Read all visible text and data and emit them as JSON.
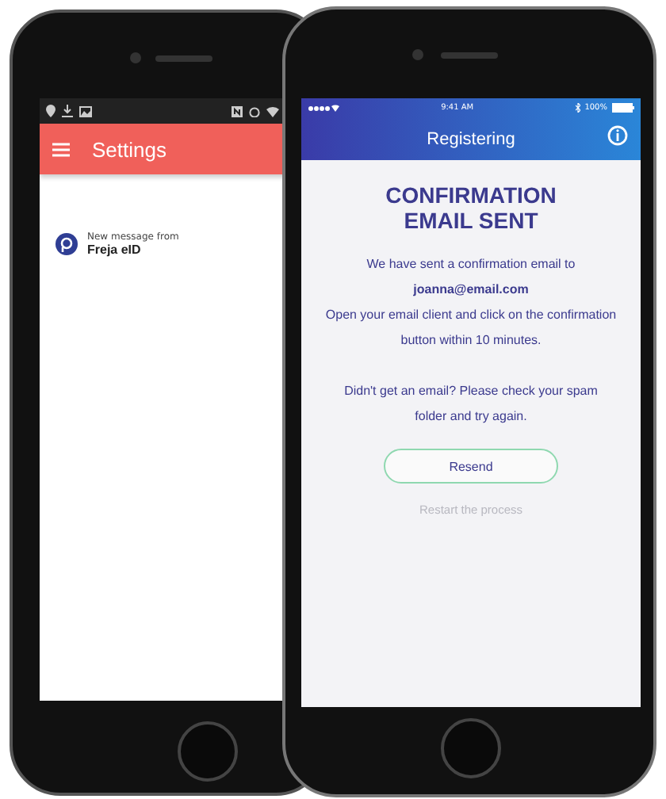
{
  "back_phone": {
    "header": {
      "title": "Settings"
    },
    "notification": {
      "label": "New message from",
      "sender": "Freja eID"
    }
  },
  "front_phone": {
    "status_bar": {
      "time": "9:41 AM",
      "battery": "100%"
    },
    "header": {
      "title": "Registering"
    },
    "title": "CONFIRMATION EMAIL SENT",
    "intro": "We have sent a confirmation email to",
    "email": "joanna@email.com",
    "instructions": "Open your email client and click on the confirmation button within 10 minutes.",
    "help": "Didn't get an email? Please check your spam folder and try again.",
    "resend_button": "Resend",
    "restart_link": "Restart the process"
  }
}
